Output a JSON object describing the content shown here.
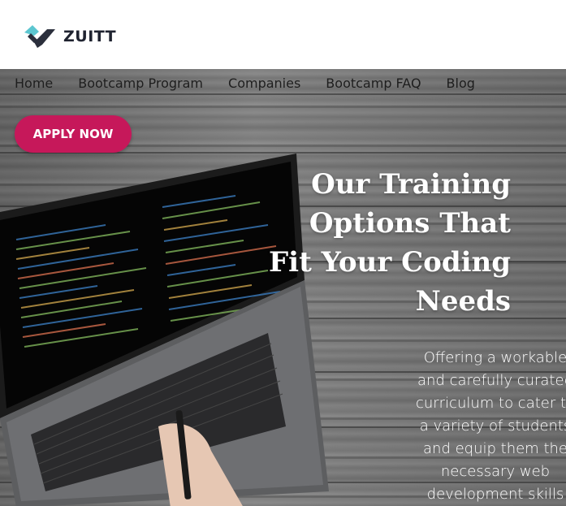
{
  "header": {
    "brand": "ZUITT",
    "colors": {
      "logo_teal": "#5cc6d0",
      "logo_dark": "#2b2f3c"
    },
    "logo_icon": "zuitt-checkmark-icon"
  },
  "nav": {
    "items": [
      "Home",
      "Bootcamp Program",
      "Companies",
      "Bootcamp FAQ",
      "Blog"
    ]
  },
  "cta": {
    "label": "APPLY NOW",
    "color": "#c6185a"
  },
  "hero": {
    "title_lines": [
      "Our Training",
      "Options That",
      "Fit Your Coding",
      "Needs"
    ],
    "description_lines": [
      "Offering a workable",
      "and carefully curated",
      "curriculum to cater to",
      "a variety of students",
      "and equip them the",
      "necessary web",
      "development skills"
    ],
    "background_image": "laptop-on-wooden-desk"
  }
}
